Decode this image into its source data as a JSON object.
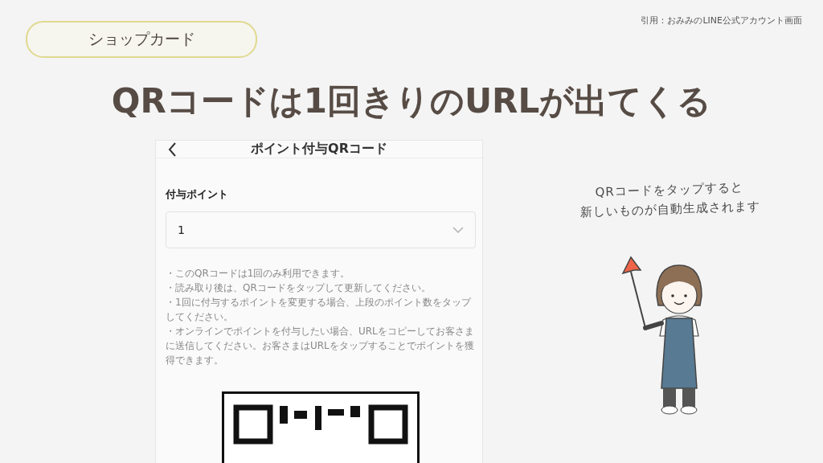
{
  "badge": "ショップカード",
  "citation": "引用：おみみのLINE公式アカウント画面",
  "headline": "QRコードは1回きりのURLが出てくる",
  "phone": {
    "title": "ポイント付与QRコード",
    "field_label": "付与ポイント",
    "select": {
      "value": "1"
    },
    "notes": [
      "・このQRコードは1回のみ利用できます。",
      "・読み取り後は、QRコードをタップして更新してください。",
      "・1回に付与するポイントを変更する場合、上段のポイント数をタップしてください。",
      "・オンラインでポイントを付与したい場合、URLをコピーしてお客さまに送信してください。お客さまはURLをタップすることでポイントを獲得できます。"
    ]
  },
  "caption": [
    "QRコードをタップすると",
    "新しいものが自動生成されます"
  ]
}
